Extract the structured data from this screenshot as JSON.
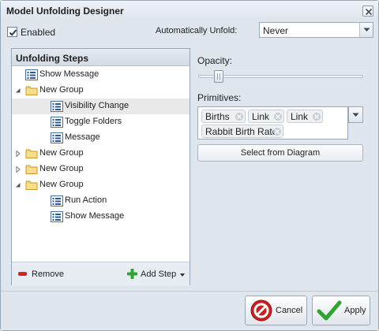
{
  "window": {
    "title": "Model Unfolding Designer"
  },
  "topbar": {
    "enabled_label": "Enabled",
    "enabled_checked": true,
    "auto_unfold_label": "Automatically Unfold:",
    "auto_unfold_value": "Never"
  },
  "steps_panel": {
    "title": "Unfolding Steps",
    "items": [
      {
        "label": "Show Message",
        "type": "step",
        "depth": 0,
        "expander": "none",
        "selected": false
      },
      {
        "label": "New Group",
        "type": "folder",
        "depth": 0,
        "expander": "expanded",
        "selected": false
      },
      {
        "label": "Visibility Change",
        "type": "step",
        "depth": 1,
        "expander": "none",
        "selected": true
      },
      {
        "label": "Toggle Folders",
        "type": "step",
        "depth": 1,
        "expander": "none",
        "selected": false
      },
      {
        "label": "Message",
        "type": "step",
        "depth": 1,
        "expander": "none",
        "selected": false
      },
      {
        "label": "New Group",
        "type": "folder",
        "depth": 0,
        "expander": "collapsed",
        "selected": false
      },
      {
        "label": "New Group",
        "type": "folder",
        "depth": 0,
        "expander": "collapsed",
        "selected": false
      },
      {
        "label": "New Group",
        "type": "folder",
        "depth": 0,
        "expander": "expanded",
        "selected": false
      },
      {
        "label": "Run Action",
        "type": "step",
        "depth": 1,
        "expander": "none",
        "selected": false
      },
      {
        "label": "Show Message",
        "type": "step",
        "depth": 1,
        "expander": "none",
        "selected": false
      }
    ],
    "remove_label": "Remove",
    "add_step_label": "Add Step"
  },
  "properties": {
    "opacity_label": "Opacity:",
    "opacity_value": 0.1,
    "primitives_label": "Primitives:",
    "primitives": [
      "Births",
      "Link",
      "Link",
      "Rabbit Birth Rate"
    ],
    "select_button_label": "Select from Diagram"
  },
  "footer": {
    "cancel_label": "Cancel",
    "apply_label": "Apply"
  },
  "colors": {
    "accent_green": "#2fa52f",
    "cancel_red": "#cc1f1f",
    "remove_red": "#d92323",
    "selection_gray": "#e9e9e9"
  },
  "icons": {
    "step": "step-list-icon",
    "folder": "folder-icon",
    "close": "close-icon",
    "cancel": "cancel-icon",
    "apply": "checkmark-icon",
    "add": "plus-icon",
    "remove": "minus-icon"
  }
}
